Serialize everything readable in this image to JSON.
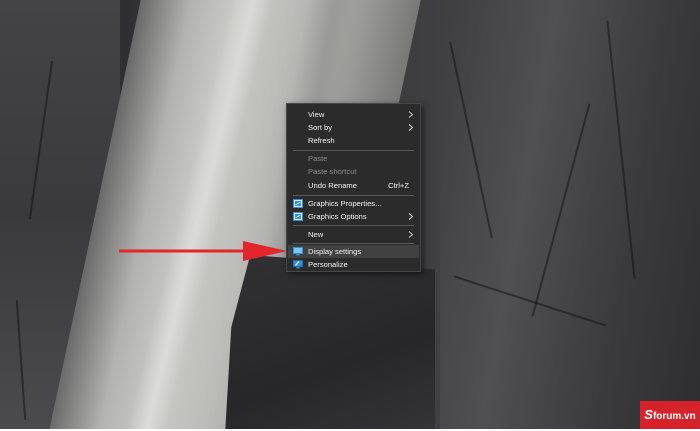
{
  "context_menu": {
    "items": [
      {
        "label": "View",
        "submenu": true
      },
      {
        "label": "Sort by",
        "submenu": true
      },
      {
        "label": "Refresh"
      },
      {
        "label": "Paste",
        "disabled": true
      },
      {
        "label": "Paste shortcut",
        "disabled": true
      },
      {
        "label": "Undo Rename",
        "shortcut": "Ctrl+Z"
      },
      {
        "label": "Graphics Properties...",
        "icon": "intel-graphics-icon"
      },
      {
        "label": "Graphics Options",
        "icon": "intel-graphics-icon",
        "submenu": true
      },
      {
        "label": "New",
        "submenu": true
      },
      {
        "label": "Display settings",
        "icon": "display-icon",
        "highlighted": true
      },
      {
        "label": "Personalize",
        "icon": "personalize-icon"
      }
    ]
  },
  "annotation": {
    "arrow_color": "#e3262b",
    "points_to": "Display settings"
  },
  "watermark": {
    "logo": "S",
    "text": "forum.vn",
    "color": "#d6232b"
  },
  "colors": {
    "menu_bg": "#2b2b2b",
    "menu_text": "#f2f2f2",
    "menu_disabled": "#8c8c8c",
    "hover_bg": "#414141",
    "icon_blue": "#2f8fe0"
  }
}
